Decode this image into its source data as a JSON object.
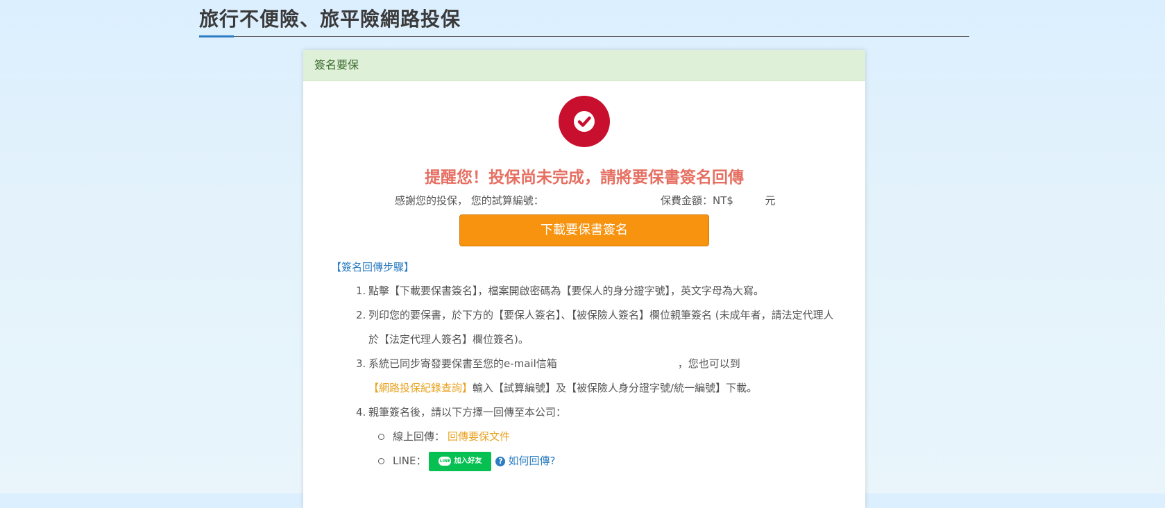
{
  "page": {
    "title": "旅行不便險、旅平險網路投保"
  },
  "card": {
    "header": "簽名要保",
    "reminder": "提醒您！投保尚未完成，請將要保書簽名回傳",
    "thanks_label": "感謝您的投保， 您的試算編號：",
    "amount_label": "保費金額：NT$",
    "amount_unit": "元",
    "download_button": "下載要保書簽名"
  },
  "steps": {
    "heading": "【簽名回傳步驟】",
    "items": [
      {
        "num": "1.",
        "text": "點擊【下載要保書簽名】，檔案開啟密碼為【要保人的身分證字號】，英文字母為大寫。"
      },
      {
        "num": "2.",
        "text": "列印您的要保書，於下方的【要保人簽名】、【被保險人簽名】欄位親筆簽名 (未成年者，請法定代理人於【法定代理人簽名】欄位簽名)。"
      },
      {
        "num": "3.",
        "text_before": "系統已同步寄發要保書至您的e-mail信箱",
        "text_mid": "，您也可以到",
        "link": "【網路投保紀錄查詢】",
        "text_after": "輸入【試算編號】及【被保險人身分證字號/統一編號】下載。"
      },
      {
        "num": "4.",
        "text": "親筆簽名後，請以下方擇一回傳至本公司："
      }
    ],
    "online_label": "線上回傳：",
    "online_link": "回傳要保文件",
    "line_label": "LINE：",
    "line_logo": "LINE",
    "line_button": "加入好友",
    "help_link": "如何回傳?"
  },
  "colors": {
    "accent_red": "#c8102e",
    "button_orange": "#f7930e",
    "link_blue": "#2b7cc2",
    "link_orange": "#e8a21f",
    "line_green": "#06c152"
  }
}
